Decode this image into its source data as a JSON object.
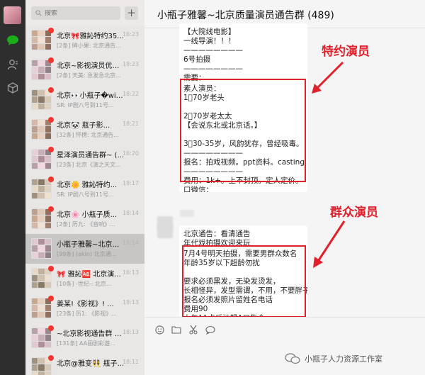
{
  "search": {
    "placeholder": "搜索"
  },
  "chat": {
    "title": "小瓶子雅馨~北京质量演员通告群 (489)"
  },
  "conversations": [
    {
      "name": "北京🎀雅訫特约35...",
      "time": "18:23",
      "preview": "[2条] 眸小果: 北京通告...",
      "unread": true
    },
    {
      "name": "北京~影视演员优质...",
      "time": "18:23",
      "preview": "[2条] 天美: 急发急北京...",
      "unread": true
    },
    {
      "name": "北京👀小瓶子�without",
      "time": "18:22",
      "preview": "SR: IP剧八号到11号...",
      "unread": true
    },
    {
      "name": "北京🐼 瓶子影...",
      "time": "18:21",
      "preview": "[32条] 怀楞: 北京通告...",
      "unread": true
    },
    {
      "name": "星泽演员通告群~ (...",
      "time": "18:20",
      "preview": "[23条] 北京《演之天文...",
      "unread": true
    },
    {
      "name": "北京🌼 雅訫特约...",
      "time": "18:17",
      "preview": "SR: IP剧八号到11号...",
      "unread": true
    },
    {
      "name": "北京🌸 小瓶子质...",
      "time": "18:14",
      "preview": "[2条] 历九: 《音响》...",
      "unread": true
    },
    {
      "name": "小瓶子雅馨~北京质...",
      "time": "18:14",
      "preview": "[99条] (akin) 北京通...",
      "unread": false
    },
    {
      "name": "🎀 雅訫🆎 北京演...",
      "time": "18:13",
      "preview": "[10条] -世纪-: 北京...",
      "unread": true
    },
    {
      "name": "姜某!《影视》! ...",
      "time": "18:13",
      "preview": "[23条] 历1: 《影视》...",
      "unread": true
    },
    {
      "name": "~北京影视通告群 🐼...",
      "time": "18:13",
      "preview": "[131条] AA画剧彩遊...",
      "unread": true
    },
    {
      "name": "北京@雅变👯 瓶子...",
      "time": "18:11",
      "preview": "",
      "unread": true
    }
  ],
  "msg1": {
    "lines_top": [
      "【大院线电影】",
      "一线导演！！！",
      "————————",
      "6号拍摄",
      "————————",
      "需要："
    ],
    "lines_box": [
      "素人演员：",
      "1⃣70岁老头",
      "",
      "2⃣70岁老太太",
      "【会说东北或北京话。】",
      "",
      "3⃣30-35岁，风韵犹存，曾经吸毒。",
      "————————",
      "报名：拍戏视频。ppt资料。casting 。",
      "————————",
      "费用：1k+。上不封顶。定人定价。"
    ],
    "lines_bottom": [
      "口微信："
    ]
  },
  "msg2": {
    "lines_top": [
      "北京通告：看清通告",
      "年代戏拍摄欢迎来玩"
    ],
    "lines_box": [
      "7月4号明天拍摄，需要男群众数名",
      "年龄35岁以下超龄勿扰",
      "",
      "要求必须黑发，无染发烫发，",
      "长相怪异，发型需谓，不用，不要胖子",
      "报名必须发照片留姓名电话",
      "费用90",
      "上午11点后沙鵦A口集合"
    ]
  },
  "annotations": {
    "special": "特约演员",
    "crowd": "群众演员"
  },
  "watermark": "小瓶子人力资源工作室",
  "colors": {
    "accent_red": "#e0202a",
    "rail": "#2e2e2e",
    "list_bg": "#e8e7e6",
    "unread_dot": "#f43530",
    "wechat_green": "#1aad19"
  }
}
